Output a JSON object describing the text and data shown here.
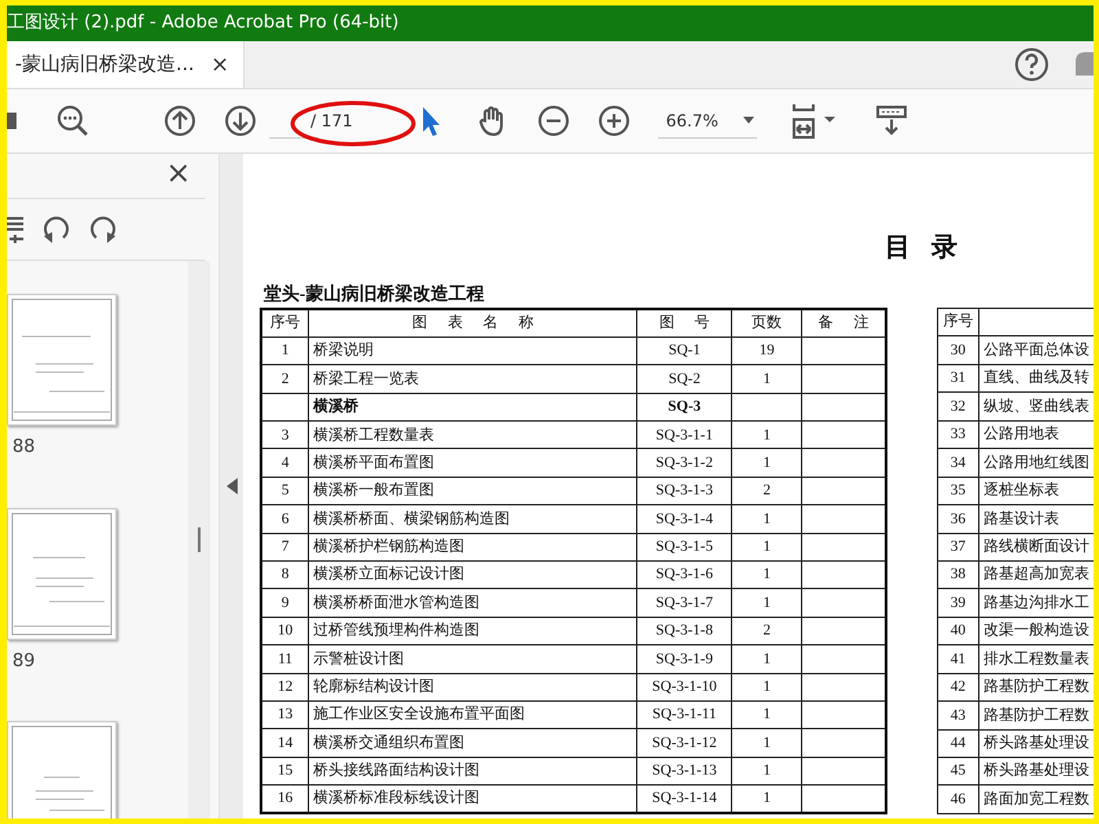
{
  "window": {
    "title": "工图设计 (2).pdf - Adobe Acrobat Pro (64-bit)"
  },
  "tab": {
    "label": "-蒙山病旧桥梁改造...",
    "close": "×",
    "selected": true
  },
  "toolbar": {
    "page_total": "/ 171",
    "zoom": "66.7%"
  },
  "sidebar": {
    "close": "×",
    "thumbnails": [
      {
        "kind": "page",
        "label": "88"
      },
      {
        "kind": "page",
        "label": "89"
      },
      {
        "kind": "page"
      }
    ]
  },
  "document": {
    "heading": "目 录",
    "subtitle": "堂头-蒙山病旧桥梁改造工程",
    "table": {
      "columns": [
        "序号",
        "图 表 名 称",
        "图 号",
        "页数",
        "备 注"
      ],
      "rows": [
        {
          "no": "1",
          "name": "桥梁说明",
          "drawing_no": "SQ-1",
          "pages": "19"
        },
        {
          "no": "2",
          "name": "桥梁工程一览表",
          "drawing_no": "SQ-2",
          "pages": "1"
        },
        {
          "kind": "section",
          "name": "横溪桥",
          "drawing_no": "SQ-3"
        },
        {
          "no": "3",
          "name": "横溪桥工程数量表",
          "drawing_no": "SQ-3-1-1",
          "pages": "1"
        },
        {
          "no": "4",
          "name": "横溪桥平面布置图",
          "drawing_no": "SQ-3-1-2",
          "pages": "1"
        },
        {
          "no": "5",
          "name": "横溪桥一般布置图",
          "drawing_no": "SQ-3-1-3",
          "pages": "2"
        },
        {
          "no": "6",
          "name": "横溪桥桥面、横梁钢筋构造图",
          "drawing_no": "SQ-3-1-4",
          "pages": "1"
        },
        {
          "no": "7",
          "name": "横溪桥护栏钢筋构造图",
          "drawing_no": "SQ-3-1-5",
          "pages": "1"
        },
        {
          "no": "8",
          "name": "横溪桥立面标记设计图",
          "drawing_no": "SQ-3-1-6",
          "pages": "1"
        },
        {
          "no": "9",
          "name": "横溪桥桥面泄水管构造图",
          "drawing_no": "SQ-3-1-7",
          "pages": "1"
        },
        {
          "no": "10",
          "name": "过桥管线预埋构件构造图",
          "drawing_no": "SQ-3-1-8",
          "pages": "2"
        },
        {
          "no": "11",
          "name": "示警桩设计图",
          "drawing_no": "SQ-3-1-9",
          "pages": "1"
        },
        {
          "no": "12",
          "name": "轮廓标结构设计图",
          "drawing_no": "SQ-3-1-10",
          "pages": "1"
        },
        {
          "no": "13",
          "name": "施工作业区安全设施布置平面图",
          "drawing_no": "SQ-3-1-11",
          "pages": "1"
        },
        {
          "no": "14",
          "name": "横溪桥交通组织布置图",
          "drawing_no": "SQ-3-1-12",
          "pages": "1"
        },
        {
          "no": "15",
          "name": "桥头接线路面结构设计图",
          "drawing_no": "SQ-3-1-13",
          "pages": "1"
        },
        {
          "no": "16",
          "name": "横溪桥标准段标线设计图",
          "drawing_no": "SQ-3-1-14",
          "pages": "1"
        }
      ]
    },
    "table_2": {
      "columns": [
        "序号"
      ],
      "rows": [
        {
          "no": "30",
          "name": "公路平面总体设"
        },
        {
          "no": "31",
          "name": "直线、曲线及转"
        },
        {
          "no": "32",
          "name": "纵坡、竖曲线表"
        },
        {
          "no": "33",
          "name": "公路用地表"
        },
        {
          "no": "34",
          "name": "公路用地红线图"
        },
        {
          "no": "35",
          "name": "逐桩坐标表"
        },
        {
          "no": "36",
          "name": "路基设计表"
        },
        {
          "no": "37",
          "name": "路线横断面设计"
        },
        {
          "no": "38",
          "name": "路基超高加宽表"
        },
        {
          "no": "39",
          "name": "路基边沟排水工"
        },
        {
          "no": "40",
          "name": "改渠一般构造设"
        },
        {
          "no": "41",
          "name": "排水工程数量表"
        },
        {
          "no": "42",
          "name": "路基防护工程数"
        },
        {
          "no": "43",
          "name": "路基防护工程数"
        },
        {
          "no": "44",
          "name": "桥头路基处理设"
        },
        {
          "no": "45",
          "name": "桥头路基处理设"
        },
        {
          "no": "46",
          "name": "路面加宽工程数"
        }
      ]
    }
  }
}
